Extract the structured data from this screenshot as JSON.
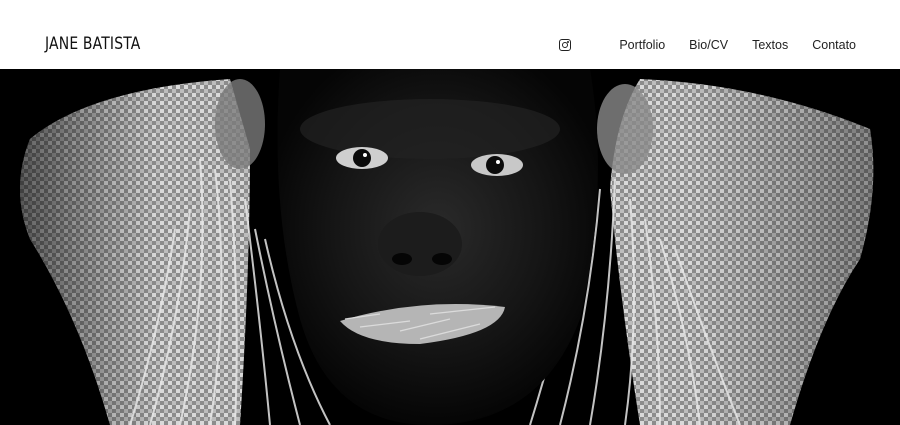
{
  "header": {
    "site_title": "JANE BATISTA",
    "instagram_icon": "instagram-icon",
    "nav": [
      {
        "label": "Portfolio"
      },
      {
        "label": "Bio/CV"
      },
      {
        "label": "Textos"
      },
      {
        "label": "Contato"
      }
    ]
  },
  "hero": {
    "image_icon": "hero-portrait-image"
  },
  "colors": {
    "background": "#ffffff",
    "text": "#222222",
    "hero_background": "#000000"
  }
}
